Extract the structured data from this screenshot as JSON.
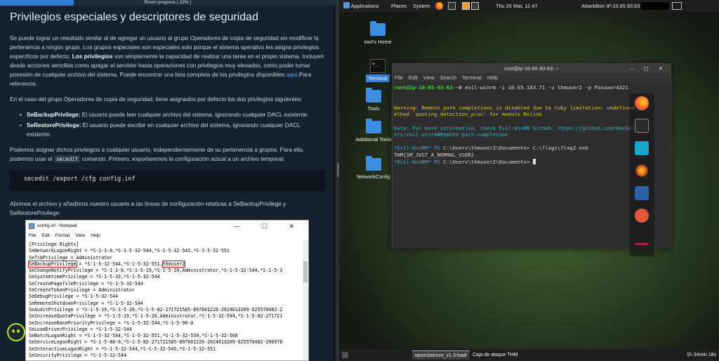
{
  "left": {
    "progress": {
      "label": "Room progress ( 22% )",
      "value": 0.22
    },
    "heading": "Privilegios especiales y descriptores de seguridad",
    "para1": {
      "t1": "Se puede lograr un resultado similar al de agregar un usuario al grupo Operadores de copia de seguridad sin modificar la pertenencia a ningún grupo. Los grupos especiales son especiales solo porque el sistema operativo les asigna privilegios específicos por defecto. ",
      "bold": "Los privilegios",
      "t2": " son simplemente la capacidad de realizar una tarea en el propio sistema. Incluyen desde acciones sencillas como apagar el servidor hasta operaciones con privilegios muy elevados, como poder tomar posesión de cualquier archivo del sistema. Puede encontrar una lista completa de los privilegios disponibles ",
      "link": "aquí",
      "t3": ".Para referencia."
    },
    "para2": "En el caso del grupo Operadores de copia de seguridad, tiene asignados por defecto los dos privilegios siguientes:",
    "bullets": [
      {
        "name": "SeBackupPrivilege:",
        "text": " El usuario puede leer cualquier archivo del sistema, ignorando cualquier DACL existente."
      },
      {
        "name": "SeRestorePrivilege:",
        "text": " El usuario puede escribir en cualquier archivo del sistema, ignorando cualquier DACL existente."
      }
    ],
    "para3": {
      "t1": "Podemos asignar dichos privilegios a cualquier usuario, independientemente de su pertenencia a grupos. Para ello, podemos usar el ",
      "code": "secedit",
      "t2": " comando. Primero, exportaremos la configuración actual a un archivo temporal:"
    },
    "codeblock": "secedit /export /cfg config.inf",
    "para4": "Abrimos el archivo y añadimos nuestro usuario a las líneas de configuración relativas a SeBackupPrivilege y SeRestorePrivilege:",
    "notepad": {
      "title": "config.inf - Notepad",
      "win_buttons": "—  ☐  ✕",
      "menu": [
        "File",
        "Edit",
        "Format",
        "View",
        "Help"
      ],
      "lines": [
        "[Privilege Rights]",
        "SeNetworkLogonRight = *S-1-1-0,*S-1-5-32-544,*S-1-5-32-545,*S-1-5-32-551",
        "SeTcbPrivilege = Administrator",
        "SeChangeNotifyPrivilege = *S-1-1-0,*S-1-5-19,*S-1-5-20,Administrator,*S-1-5-32-544,*S-1-5-3",
        "SeSystemtimePrivilege = *S-1-5-19,*S-1-5-32-544",
        "SeCreatePagefilePrivilege = *S-1-5-32-544",
        "SeCreateTokenPrivilege = Administrator",
        "SeDebugPrivilege = *S-1-5-32-544",
        "SeRemoteShutdownPrivilege = *S-1-5-32-544",
        "SeAuditPrivilege = *S-1-5-19,*S-1-5-20,*S-1-5-82-271721585-897601226-2024613209-625570482-2",
        "SeIncreaseQuotaPrivilege = *S-1-5-19,*S-1-5-20,Administrator,*S-1-5-32-544,*S-1-5-82-271721",
        "SeIncreaseBasePriorityPrivilege = *S-1-5-32-544,*S-1-5-90-0",
        "SeLoadDriverPrivilege = *S-1-5-32-544",
        "SeBatchLogonRight = *S-1-5-32-544,*S-1-5-32-551,*S-1-5-32-559,*S-1-5-32-568",
        "SeServiceLogonRight = *S-1-5-80-0,*S-1-5-82-271721585-897601226-2024613209-625570482-296978",
        "SeInteractiveLogonRight = *S-1-5-32-544,*S-1-5-32-545,*S-1-5-32-551",
        "SeSecurityPrivilege = *S-1-5-32-544"
      ],
      "hl_line": {
        "prefix": "SeBackupPrivilege",
        "middle": " = *S-1-5-32-544,*S-1-5-32-551,",
        "user": "thmuser2"
      }
    }
  },
  "desktop": {
    "topbar": {
      "applications": "Applications",
      "places": "Places",
      "system": "System",
      "datetime": "Thu 26 Mar, 11:47",
      "ip": "AttackBox IP:10.65.93.63"
    },
    "icons": {
      "home": "root's Home",
      "terminal": "Terminal",
      "tools": "Tools",
      "additional": "Additional Tools",
      "network": "NetworkConfig"
    },
    "terminal": {
      "title": "root@ip-10-65-93-63: ~",
      "buttons": "–  ▢  ✕",
      "menu": [
        "File",
        "Edit",
        "View",
        "Search",
        "Terminal",
        "Help"
      ],
      "prompt": "root@ip-10-65-93-63",
      "prompt_suffix": ":~# ",
      "command": "evil-winrm -i 10.65.183.71 -u thmuser2 -p Password321",
      "warn1": "Warning: Remote path completions is disabled due to ruby limitation: undefined m",
      "warn2": "ethod `quoting_detection_proc' for module Reline",
      "info1": "Data: For more information, check Evil-WinRM GitHub: https://github.com/Hackplay",
      "info2": "ers/evil-winrm#Remote-path-completion",
      "ps_label": "*Evil-WinRM* PS ",
      "ps_path": "C:\\Users\\thmuser2\\Documents>",
      "cmd2": " C:\\flags\\flag2.exe",
      "output": "THM{IM_JUST_A_NORMAL_USER}"
    },
    "taskbar": {
      "item1": "wpersistence_v1.3-badr",
      "item2": "Caja de ataque THM",
      "time": "1h 34min 18s"
    }
  }
}
